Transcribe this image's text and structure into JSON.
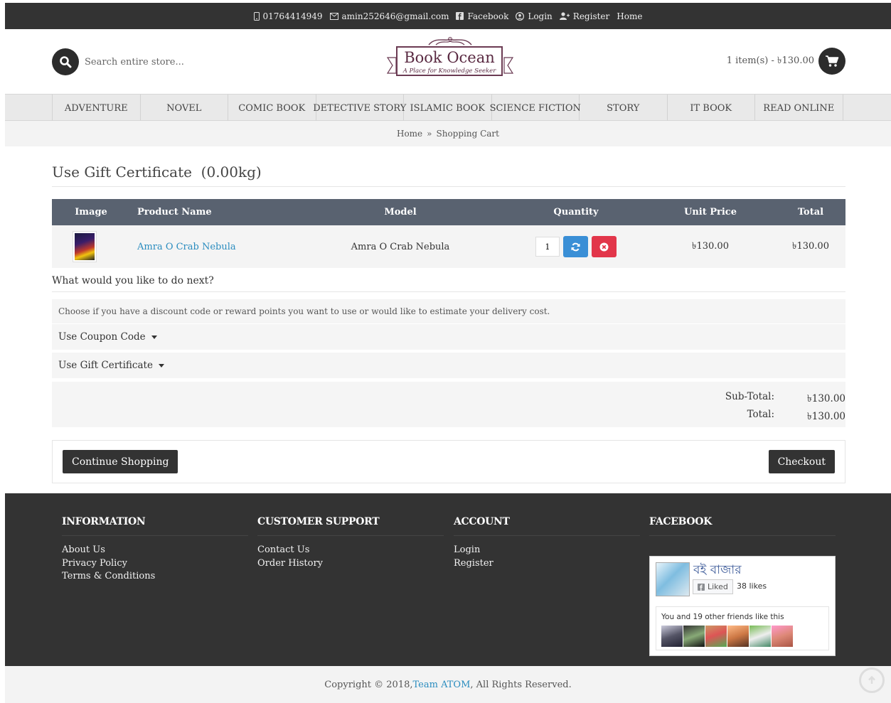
{
  "topbar": {
    "phone": "01764414949",
    "email": "amin252646@gmail.com",
    "facebook": "Facebook",
    "login": "Login",
    "register": "Register",
    "home": "Home"
  },
  "header": {
    "search_placeholder": "Search entire store...",
    "logo_title": "Book Ocean",
    "logo_subtitle": "A Place for Knowledge Seeker",
    "cart_summary": "1 item(s) - ৳130.00"
  },
  "nav": {
    "items": [
      "ADVENTURE",
      "NOVEL",
      "COMIC BOOK",
      "DETECTIVE STORY",
      "ISLAMIC BOOK",
      "SCIENCE FICTION",
      "STORY",
      "IT BOOK",
      "READ ONLINE"
    ]
  },
  "breadcrumb": {
    "home": "Home",
    "sep": "»",
    "current": "Shopping Cart"
  },
  "main": {
    "title": "Use Gift Certificate",
    "weight": "(0.00kg)",
    "table": {
      "headers": {
        "image": "Image",
        "name": "Product Name",
        "model": "Model",
        "quantity": "Quantity",
        "unit_price": "Unit Price",
        "total": "Total"
      },
      "rows": [
        {
          "name": "Amra O Crab Nebula",
          "model": "Amra O Crab Nebula",
          "quantity": "1",
          "unit_price": "৳130.00",
          "total": "৳130.00"
        }
      ]
    },
    "next_title": "What would you like to do next?",
    "next_desc": "Choose if you have a discount code or reward points you want to use or would like to estimate your delivery cost.",
    "coupon": "Use Coupon Code",
    "gift": "Use Gift Certificate",
    "subtotal_label": "Sub-Total:",
    "subtotal": "৳130.00",
    "total_label": "Total:",
    "total": "৳130.00",
    "continue": "Continue Shopping",
    "checkout": "Checkout"
  },
  "footer": {
    "information": {
      "title": "INFORMATION",
      "links": [
        "About Us",
        "Privacy Policy",
        "Terms & Conditions"
      ]
    },
    "support": {
      "title": "CUSTOMER SUPPORT",
      "links": [
        "Contact Us",
        "Order History"
      ]
    },
    "account": {
      "title": "ACCOUNT",
      "links": [
        "Login",
        "Register"
      ]
    },
    "facebook": {
      "title": "FACEBOOK",
      "page_name": "বই বাজার",
      "liked": "Liked",
      "likes": "38 likes",
      "friends": "You and 19 other friends like this"
    }
  },
  "copyright": {
    "prefix": "Copyright © 2018, ",
    "team": "Team ATOM",
    "suffix": ", All Rights Reserved."
  },
  "colors": {
    "dark": "#333333",
    "table_header": "#596270",
    "link": "#2a8cbf",
    "refresh": "#3a8fd6",
    "remove": "#e2364a"
  }
}
